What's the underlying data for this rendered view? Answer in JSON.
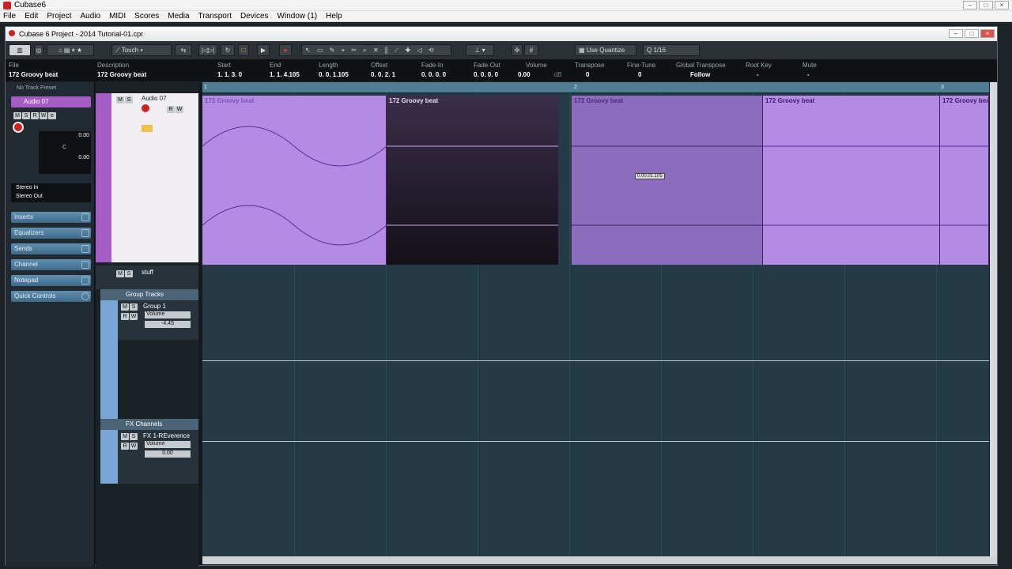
{
  "app": {
    "title": "Cubase6"
  },
  "menu": [
    "File",
    "Edit",
    "Project",
    "Audio",
    "MIDI",
    "Scores",
    "Media",
    "Transport",
    "Devices",
    "Window (1)",
    "Help"
  ],
  "project": {
    "window_title": "Cubase 6 Project - 2014 Tutorial-01.cpr"
  },
  "toolbar": {
    "automation_mode": "Touch",
    "quantize_label": "Use Quantize",
    "quantize_value": "1/16"
  },
  "infoline": {
    "file": {
      "label": "File",
      "value": "172 Groovy beat"
    },
    "description": {
      "label": "Description",
      "value": "172 Groovy beat"
    },
    "start": {
      "label": "Start",
      "value": "1. 1. 3.   0"
    },
    "end": {
      "label": "End",
      "value": "1. 1. 4.105"
    },
    "length": {
      "label": "Length",
      "value": "0. 0. 1.105"
    },
    "offset": {
      "label": "Offset",
      "value": "0. 0. 2.   1"
    },
    "fadein": {
      "label": "Fade-In",
      "value": "0. 0. 0.   0"
    },
    "fadeout": {
      "label": "Fade-Out",
      "value": "0. 0. 0.   0"
    },
    "volume": {
      "label": "Volume",
      "value": "0.00",
      "unit": "dB"
    },
    "transpose": {
      "label": "Transpose",
      "value": "0"
    },
    "finetune": {
      "label": "Fine-Tune",
      "value": "0"
    },
    "globaltranspose": {
      "label": "Global Transpose",
      "value": "Follow"
    },
    "rootkey": {
      "label": "Root Key",
      "value": "-"
    },
    "mute": {
      "label": "Mute",
      "value": "-"
    }
  },
  "inspector": {
    "preset": "No Track Preset",
    "track_name": "Audio 07",
    "volume": "0.00",
    "pan": "C",
    "delay": "0.00",
    "input": "Stereo In",
    "output": "Stereo Out",
    "sections": [
      "Inserts",
      "Equalizers",
      "Sends",
      "Channel",
      "Notepad",
      "Quick Controls"
    ]
  },
  "tracks": {
    "audio": {
      "name": "Audio 07"
    },
    "folder": {
      "name": "stuff"
    },
    "group_folder": {
      "name": "Group Tracks"
    },
    "group": {
      "name": "Group 1",
      "param": "Volume",
      "value": "-4.45"
    },
    "fx_folder": {
      "name": "FX Channels"
    },
    "fx": {
      "name": "FX 1-REverence",
      "param": "Volume",
      "value": "0.00"
    }
  },
  "events": [
    {
      "name": "172 Groovy beat"
    },
    {
      "name": "172 Groovy beat"
    },
    {
      "name": "172 Groovy beat"
    },
    {
      "name": "172 Groovy beat"
    },
    {
      "name": "172 Groovy beat"
    }
  ],
  "ruler": {
    "marks": [
      "1",
      "2",
      "3"
    ]
  },
  "cursor_tooltip": "0.00.01.105"
}
